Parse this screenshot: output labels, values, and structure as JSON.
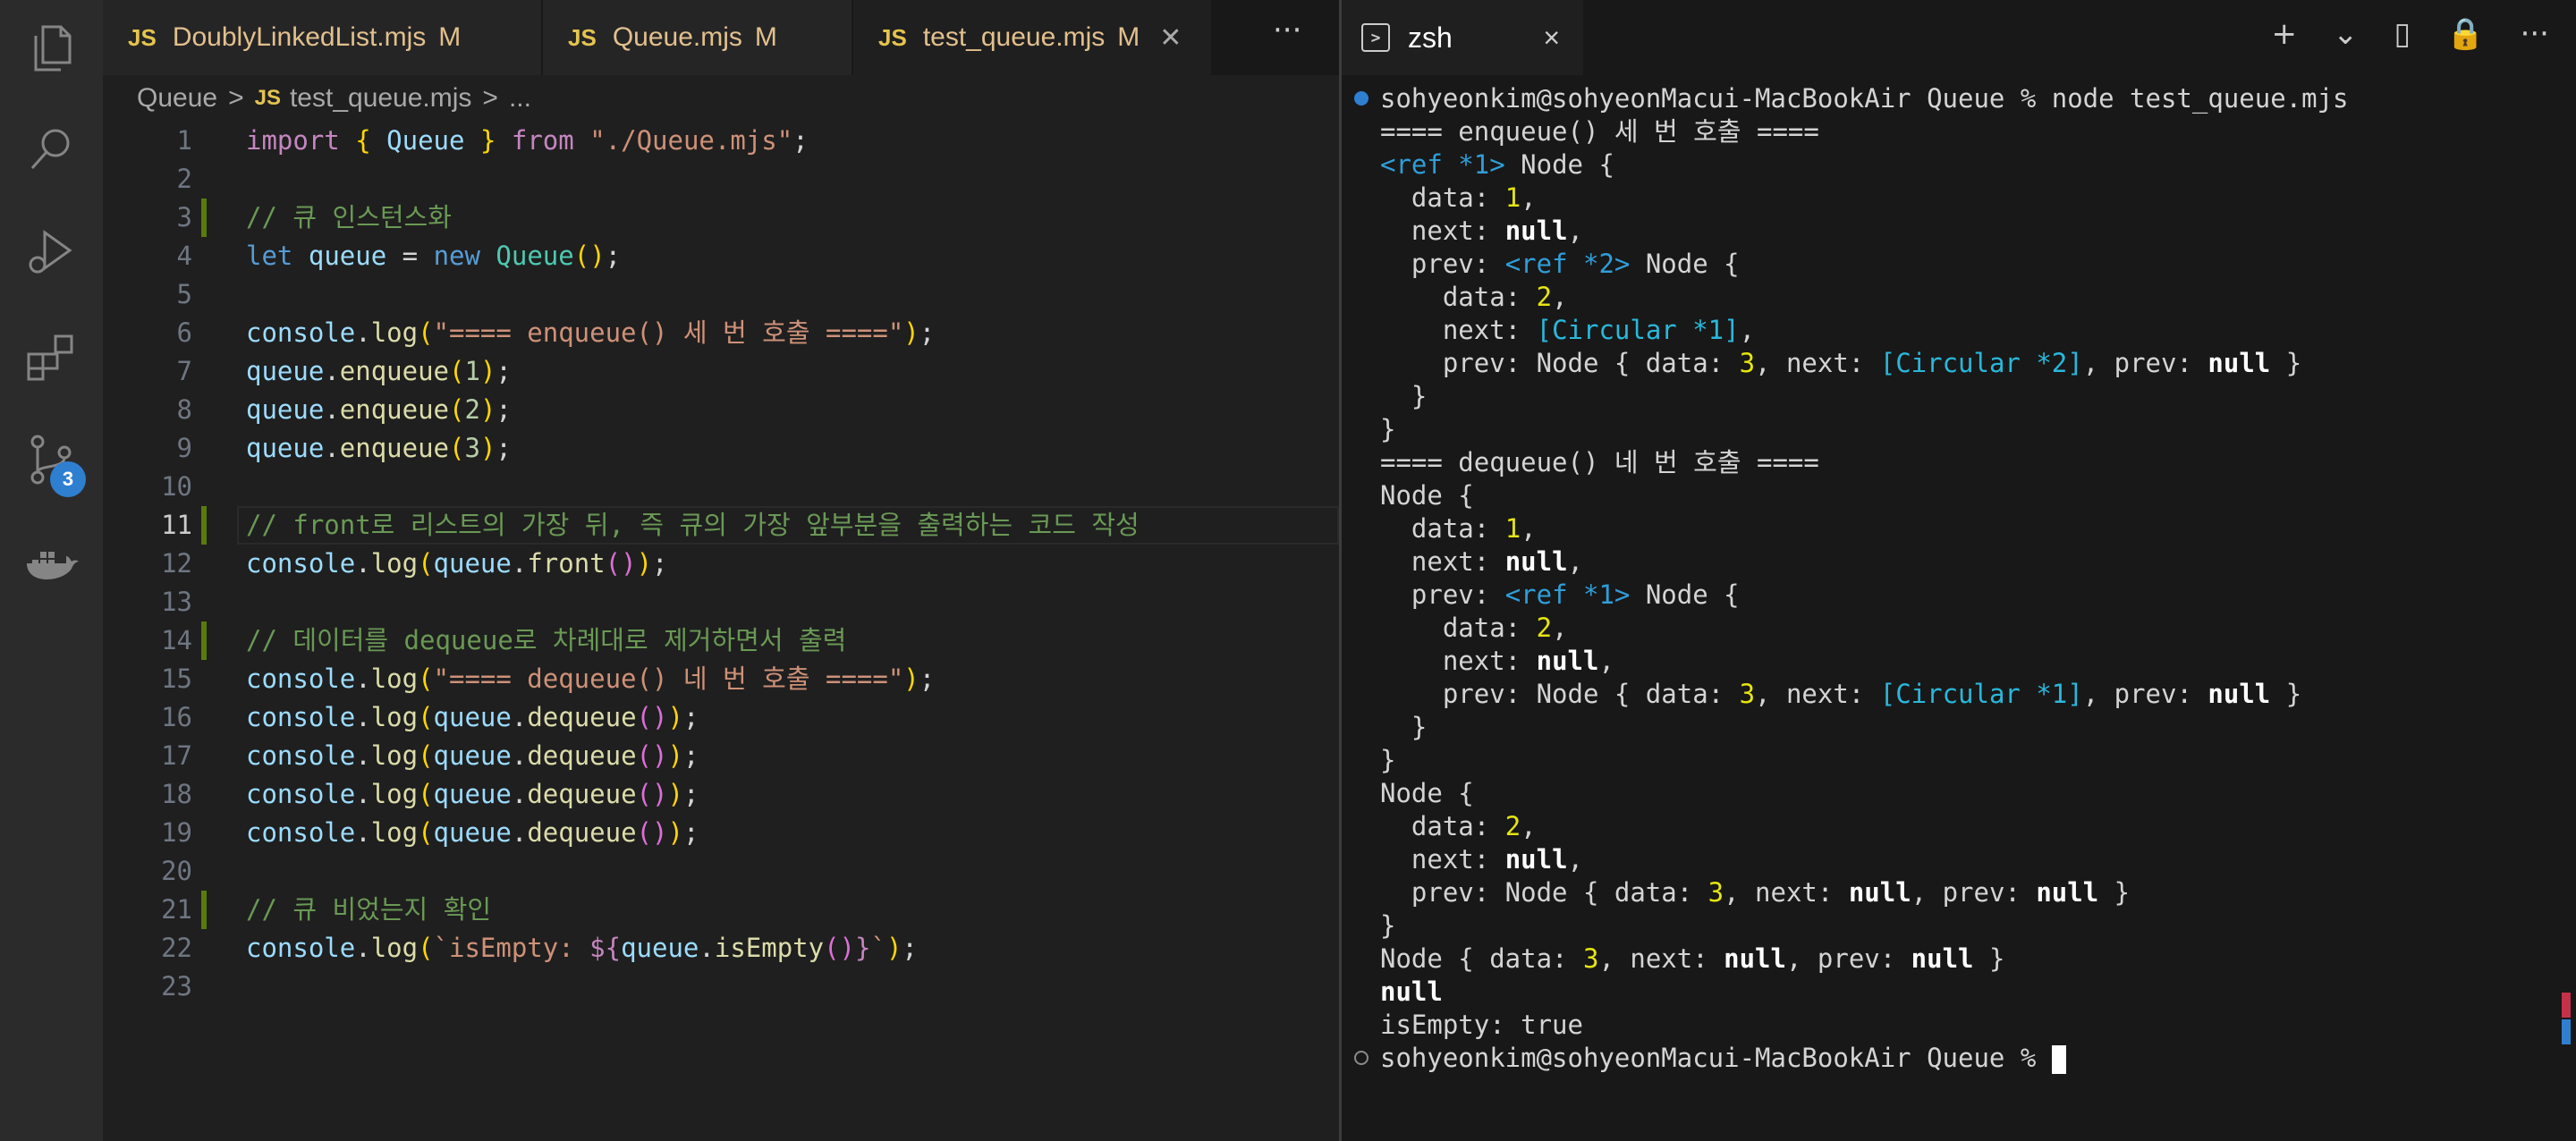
{
  "editor": {
    "tabs": [
      {
        "icon": "JS",
        "name": "DoublyLinkedList.mjs",
        "status": "M",
        "active": false
      },
      {
        "icon": "JS",
        "name": "Queue.mjs",
        "status": "M",
        "active": false
      },
      {
        "icon": "JS",
        "name": "test_queue.mjs",
        "status": "M",
        "active": true
      }
    ],
    "more": "···",
    "breadcrumb": {
      "folder": "Queue",
      "sep": ">",
      "file_icon": "JS",
      "file": "test_queue.mjs",
      "tail": "..."
    },
    "line_numbers": [
      "1",
      "2",
      "3",
      "4",
      "5",
      "6",
      "7",
      "8",
      "9",
      "10",
      "11",
      "12",
      "13",
      "14",
      "15",
      "16",
      "17",
      "18",
      "19",
      "20",
      "21",
      "22",
      "23"
    ],
    "current_line": 11,
    "code": [
      [
        [
          "kw",
          "import"
        ],
        [
          "pl",
          " "
        ],
        [
          "br1",
          "{"
        ],
        [
          "pl",
          " "
        ],
        [
          "var",
          "Queue"
        ],
        [
          "pl",
          " "
        ],
        [
          "br1",
          "}"
        ],
        [
          "pl",
          " "
        ],
        [
          "kw",
          "from"
        ],
        [
          "pl",
          " "
        ],
        [
          "str",
          "\"./Queue.mjs\""
        ],
        [
          "pl",
          ";"
        ]
      ],
      [],
      [
        [
          "cm",
          "// 큐 인스턴스화"
        ]
      ],
      [
        [
          "kw2",
          "let"
        ],
        [
          "pl",
          " "
        ],
        [
          "var",
          "queue"
        ],
        [
          "pl",
          " = "
        ],
        [
          "kw2",
          "new"
        ],
        [
          "pl",
          " "
        ],
        [
          "cls",
          "Queue"
        ],
        [
          "br1",
          "()"
        ],
        [
          "pl",
          ";"
        ]
      ],
      [],
      [
        [
          "var",
          "console"
        ],
        [
          "pl",
          "."
        ],
        [
          "fn",
          "log"
        ],
        [
          "br1",
          "("
        ],
        [
          "str",
          "\"==== enqueue() 세 번 호출 ====\""
        ],
        [
          "br1",
          ")"
        ],
        [
          "pl",
          ";"
        ]
      ],
      [
        [
          "var",
          "queue"
        ],
        [
          "pl",
          "."
        ],
        [
          "fn",
          "enqueue"
        ],
        [
          "br1",
          "("
        ],
        [
          "num",
          "1"
        ],
        [
          "br1",
          ")"
        ],
        [
          "pl",
          ";"
        ]
      ],
      [
        [
          "var",
          "queue"
        ],
        [
          "pl",
          "."
        ],
        [
          "fn",
          "enqueue"
        ],
        [
          "br1",
          "("
        ],
        [
          "num",
          "2"
        ],
        [
          "br1",
          ")"
        ],
        [
          "pl",
          ";"
        ]
      ],
      [
        [
          "var",
          "queue"
        ],
        [
          "pl",
          "."
        ],
        [
          "fn",
          "enqueue"
        ],
        [
          "br1",
          "("
        ],
        [
          "num",
          "3"
        ],
        [
          "br1",
          ")"
        ],
        [
          "pl",
          ";"
        ]
      ],
      [],
      [
        [
          "cm",
          "// front로 리스트의 가장 뒤, 즉 큐의 가장 앞부분을 출력하는 코드 작성"
        ]
      ],
      [
        [
          "var",
          "console"
        ],
        [
          "pl",
          "."
        ],
        [
          "fn",
          "log"
        ],
        [
          "br1",
          "("
        ],
        [
          "var",
          "queue"
        ],
        [
          "pl",
          "."
        ],
        [
          "fn",
          "front"
        ],
        [
          "br2",
          "()"
        ],
        [
          "br1",
          ")"
        ],
        [
          "pl",
          ";"
        ]
      ],
      [],
      [
        [
          "cm",
          "// 데이터를 dequeue로 차례대로 제거하면서 출력"
        ]
      ],
      [
        [
          "var",
          "console"
        ],
        [
          "pl",
          "."
        ],
        [
          "fn",
          "log"
        ],
        [
          "br1",
          "("
        ],
        [
          "str",
          "\"==== dequeue() 네 번 호출 ====\""
        ],
        [
          "br1",
          ")"
        ],
        [
          "pl",
          ";"
        ]
      ],
      [
        [
          "var",
          "console"
        ],
        [
          "pl",
          "."
        ],
        [
          "fn",
          "log"
        ],
        [
          "br1",
          "("
        ],
        [
          "var",
          "queue"
        ],
        [
          "pl",
          "."
        ],
        [
          "fn",
          "dequeue"
        ],
        [
          "br2",
          "()"
        ],
        [
          "br1",
          ")"
        ],
        [
          "pl",
          ";"
        ]
      ],
      [
        [
          "var",
          "console"
        ],
        [
          "pl",
          "."
        ],
        [
          "fn",
          "log"
        ],
        [
          "br1",
          "("
        ],
        [
          "var",
          "queue"
        ],
        [
          "pl",
          "."
        ],
        [
          "fn",
          "dequeue"
        ],
        [
          "br2",
          "()"
        ],
        [
          "br1",
          ")"
        ],
        [
          "pl",
          ";"
        ]
      ],
      [
        [
          "var",
          "console"
        ],
        [
          "pl",
          "."
        ],
        [
          "fn",
          "log"
        ],
        [
          "br1",
          "("
        ],
        [
          "var",
          "queue"
        ],
        [
          "pl",
          "."
        ],
        [
          "fn",
          "dequeue"
        ],
        [
          "br2",
          "()"
        ],
        [
          "br1",
          ")"
        ],
        [
          "pl",
          ";"
        ]
      ],
      [
        [
          "var",
          "console"
        ],
        [
          "pl",
          "."
        ],
        [
          "fn",
          "log"
        ],
        [
          "br1",
          "("
        ],
        [
          "var",
          "queue"
        ],
        [
          "pl",
          "."
        ],
        [
          "fn",
          "dequeue"
        ],
        [
          "br2",
          "()"
        ],
        [
          "br1",
          ")"
        ],
        [
          "pl",
          ";"
        ]
      ],
      [],
      [
        [
          "cm",
          "// 큐 비었는지 확인"
        ]
      ],
      [
        [
          "var",
          "console"
        ],
        [
          "pl",
          "."
        ],
        [
          "fn",
          "log"
        ],
        [
          "br1",
          "("
        ],
        [
          "str",
          "`isEmpty: "
        ],
        [
          "kw",
          "${"
        ],
        [
          "var",
          "queue"
        ],
        [
          "pl",
          "."
        ],
        [
          "fn",
          "isEmpty"
        ],
        [
          "br2",
          "()"
        ],
        [
          "kw",
          "}"
        ],
        [
          "str",
          "`"
        ],
        [
          "br1",
          ")"
        ],
        [
          "pl",
          ";"
        ]
      ],
      []
    ],
    "modified_lines": [
      3,
      11,
      14,
      21
    ],
    "colors": {
      "modified_gutter": "#587c0c",
      "accent": "#e4c44e"
    }
  },
  "activity_bar": {
    "icons": [
      "files-icon",
      "search-icon",
      "run-debug-icon",
      "extensions-icon",
      "source-control-icon",
      "docker-icon"
    ],
    "source_control_badge": "3"
  },
  "terminal": {
    "tab_label": "zsh",
    "close": "×",
    "actions": [
      "+",
      "⌄",
      "▯",
      "🔒",
      "···"
    ],
    "lines": [
      [
        [
          "pl",
          "sohyeonkim@sohyeonMacui-MacBookAir Queue % node test_queue.mjs"
        ]
      ],
      [
        [
          "pl",
          "==== enqueue() 세 번 호출 ===="
        ]
      ],
      [
        [
          "tcy",
          "<ref *1>"
        ],
        [
          "pl",
          " Node {"
        ]
      ],
      [
        [
          "pl",
          "  data: "
        ],
        [
          "ty",
          "1"
        ],
        [
          "pl",
          ","
        ]
      ],
      [
        [
          "pl",
          "  next: "
        ],
        [
          "tb",
          "null"
        ],
        [
          "pl",
          ","
        ]
      ],
      [
        [
          "pl",
          "  prev: "
        ],
        [
          "tcy",
          "<ref *2>"
        ],
        [
          "pl",
          " Node {"
        ]
      ],
      [
        [
          "pl",
          "    data: "
        ],
        [
          "ty",
          "2"
        ],
        [
          "pl",
          ","
        ]
      ],
      [
        [
          "pl",
          "    next: "
        ],
        [
          "tc",
          "[Circular *1]"
        ],
        [
          "pl",
          ","
        ]
      ],
      [
        [
          "pl",
          "    prev: Node { data: "
        ],
        [
          "ty",
          "3"
        ],
        [
          "pl",
          ", next: "
        ],
        [
          "tc",
          "[Circular *2]"
        ],
        [
          "pl",
          ", prev: "
        ],
        [
          "tb",
          "null"
        ],
        [
          "pl",
          " }"
        ]
      ],
      [
        [
          "pl",
          "  }"
        ]
      ],
      [
        [
          "pl",
          "}"
        ]
      ],
      [
        [
          "pl",
          "==== dequeue() 네 번 호출 ===="
        ]
      ],
      [
        [
          "pl",
          "Node {"
        ]
      ],
      [
        [
          "pl",
          "  data: "
        ],
        [
          "ty",
          "1"
        ],
        [
          "pl",
          ","
        ]
      ],
      [
        [
          "pl",
          "  next: "
        ],
        [
          "tb",
          "null"
        ],
        [
          "pl",
          ","
        ]
      ],
      [
        [
          "pl",
          "  prev: "
        ],
        [
          "tcy",
          "<ref *1>"
        ],
        [
          "pl",
          " Node {"
        ]
      ],
      [
        [
          "pl",
          "    data: "
        ],
        [
          "ty",
          "2"
        ],
        [
          "pl",
          ","
        ]
      ],
      [
        [
          "pl",
          "    next: "
        ],
        [
          "tb",
          "null"
        ],
        [
          "pl",
          ","
        ]
      ],
      [
        [
          "pl",
          "    prev: Node { data: "
        ],
        [
          "ty",
          "3"
        ],
        [
          "pl",
          ", next: "
        ],
        [
          "tc",
          "[Circular *1]"
        ],
        [
          "pl",
          ", prev: "
        ],
        [
          "tb",
          "null"
        ],
        [
          "pl",
          " }"
        ]
      ],
      [
        [
          "pl",
          "  }"
        ]
      ],
      [
        [
          "pl",
          "}"
        ]
      ],
      [
        [
          "pl",
          "Node {"
        ]
      ],
      [
        [
          "pl",
          "  data: "
        ],
        [
          "ty",
          "2"
        ],
        [
          "pl",
          ","
        ]
      ],
      [
        [
          "pl",
          "  next: "
        ],
        [
          "tb",
          "null"
        ],
        [
          "pl",
          ","
        ]
      ],
      [
        [
          "pl",
          "  prev: Node { data: "
        ],
        [
          "ty",
          "3"
        ],
        [
          "pl",
          ", next: "
        ],
        [
          "tb",
          "null"
        ],
        [
          "pl",
          ", prev: "
        ],
        [
          "tb",
          "null"
        ],
        [
          "pl",
          " }"
        ]
      ],
      [
        [
          "pl",
          "}"
        ]
      ],
      [
        [
          "pl",
          "Node { data: "
        ],
        [
          "ty",
          "3"
        ],
        [
          "pl",
          ", next: "
        ],
        [
          "tb",
          "null"
        ],
        [
          "pl",
          ", prev: "
        ],
        [
          "tb",
          "null"
        ],
        [
          "pl",
          " }"
        ]
      ],
      [
        [
          "tb",
          "null"
        ]
      ],
      [
        [
          "pl",
          "isEmpty: true"
        ]
      ],
      [
        [
          "pl",
          "sohyeonkim@sohyeonMacui-MacBookAir Queue % "
        ]
      ]
    ],
    "colors": {
      "prompt_dot_active": "#2f7fd1",
      "number": "#e5e510",
      "circular": "#29b8db"
    }
  }
}
